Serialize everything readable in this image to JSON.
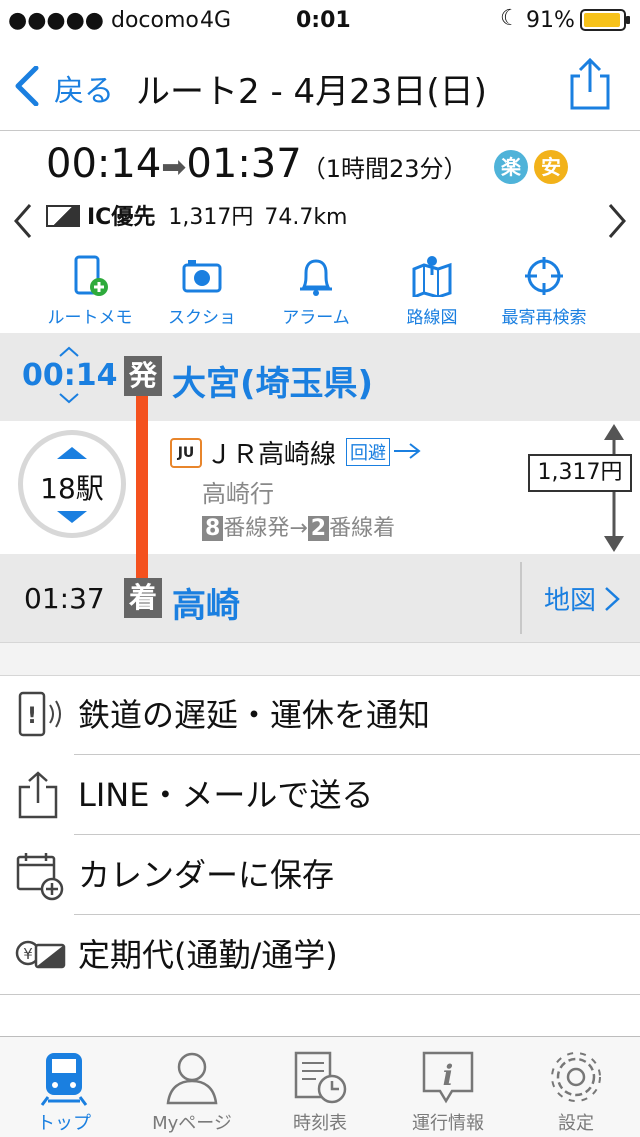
{
  "status_bar": {
    "carrier": "●●●●● docomo",
    "network": "4G",
    "time": "0:01",
    "battery": "91%"
  },
  "nav": {
    "back_label": "戻る",
    "title": "ルート2 - 4月23日(日)"
  },
  "summary": {
    "dep_time": "00:14",
    "arrow": "➡",
    "arr_time": "01:37",
    "duration": "（1時間23分）",
    "badge_raku": "楽",
    "badge_an": "安",
    "fare_mode": "IC優先",
    "fare": "1,317円",
    "distance": "74.7km"
  },
  "actions": [
    {
      "label": "ルートメモ",
      "icon": "memo-phone-icon"
    },
    {
      "label": "スクショ",
      "icon": "camera-icon"
    },
    {
      "label": "アラーム",
      "icon": "bell-icon"
    },
    {
      "label": "路線図",
      "icon": "map-pin-icon"
    },
    {
      "label": "最寄再検索",
      "icon": "crosshair-icon"
    }
  ],
  "route": {
    "dep": {
      "time": "00:14",
      "badge": "発",
      "station": "大宮(埼玉県)"
    },
    "stops": "18駅",
    "line": {
      "code": "JU",
      "name": "ＪＲ高崎線",
      "detour_label": "回避",
      "direction": "高崎行",
      "platform_dep_num": "8",
      "platform_dep": "番線発→",
      "platform_arr_num": "2",
      "platform_arr": "番線着"
    },
    "fare": "1,317円",
    "arr": {
      "time": "01:37",
      "badge": "着",
      "station": "高崎",
      "map_label": "地図"
    }
  },
  "menu": [
    {
      "label": "鉄道の遅延・運休を通知",
      "icon": "delay-notify-icon"
    },
    {
      "label": "LINE・メールで送る",
      "icon": "share-icon"
    },
    {
      "label": "カレンダーに保存",
      "icon": "calendar-add-icon"
    },
    {
      "label": "定期代(通勤/通学)",
      "icon": "commuter-pass-icon"
    }
  ],
  "tabs": [
    {
      "label": "トップ",
      "icon": "train-icon",
      "active": true
    },
    {
      "label": "Myページ",
      "icon": "person-icon",
      "active": false
    },
    {
      "label": "時刻表",
      "icon": "timetable-icon",
      "active": false
    },
    {
      "label": "運行情報",
      "icon": "info-icon",
      "active": false
    },
    {
      "label": "設定",
      "icon": "gear-icon",
      "active": false
    }
  ],
  "colors": {
    "accent": "#1a7fe0",
    "route_line": "#f4511e",
    "line_badge": "#e8852b",
    "raku": "#4fb3d9",
    "an": "#f2b21a",
    "battery": "#f7c21a"
  }
}
